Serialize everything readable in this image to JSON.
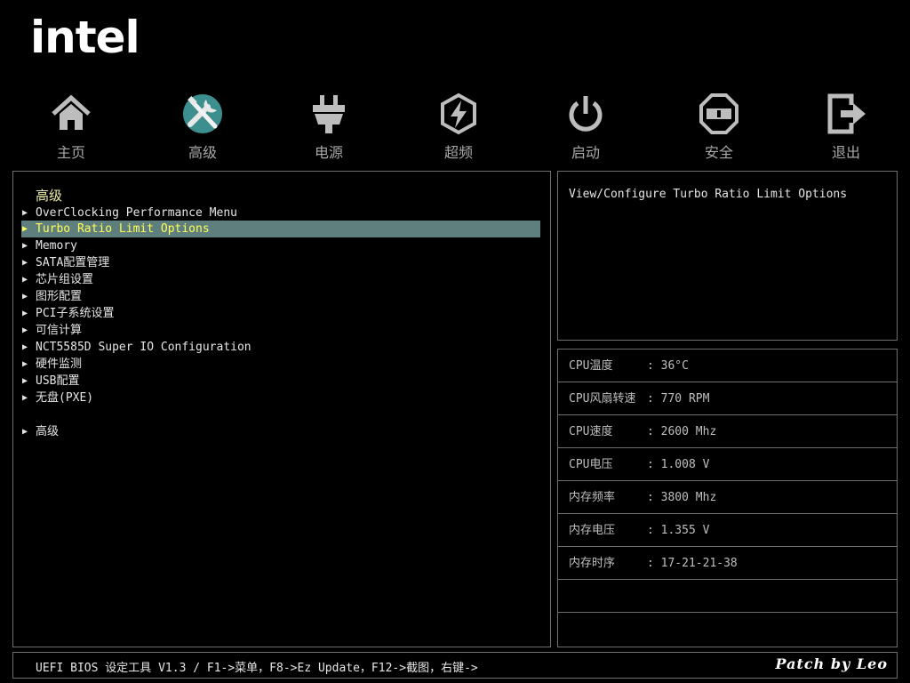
{
  "brand": {
    "logo_text": "intel"
  },
  "nav": {
    "items": [
      {
        "label": "主页",
        "icon": "home-icon"
      },
      {
        "label": "高级",
        "icon": "tools-icon",
        "active": true
      },
      {
        "label": "电源",
        "icon": "power-plug-icon"
      },
      {
        "label": "超频",
        "icon": "overclock-icon"
      },
      {
        "label": "启动",
        "icon": "power-button-icon"
      },
      {
        "label": "安全",
        "icon": "shield-icon"
      },
      {
        "label": "退出",
        "icon": "exit-icon"
      }
    ]
  },
  "menu": {
    "title": "高级",
    "items": [
      {
        "label": "OverClocking Performance Menu"
      },
      {
        "label": "Turbo Ratio Limit Options",
        "selected": true
      },
      {
        "label": "Memory"
      },
      {
        "label": "SATA配置管理"
      },
      {
        "label": "芯片组设置"
      },
      {
        "label": "图形配置"
      },
      {
        "label": "PCI子系统设置"
      },
      {
        "label": "可信计算"
      },
      {
        "label": "NCT5585D Super IO Configuration"
      },
      {
        "label": "硬件监测"
      },
      {
        "label": "USB配置"
      },
      {
        "label": "无盘(PXE)"
      },
      {
        "label": "高级"
      }
    ]
  },
  "help": {
    "text": "View/Configure Turbo Ratio Limit Options"
  },
  "status": {
    "rows": [
      {
        "label": "CPU温度",
        "value": ": 36°C"
      },
      {
        "label": "CPU风扇转速",
        "value": ": 770 RPM"
      },
      {
        "label": "CPU速度",
        "value": ": 2600 Mhz"
      },
      {
        "label": "CPU电压",
        "value": ": 1.008 V"
      },
      {
        "label": "内存频率",
        "value": ": 3800 Mhz"
      },
      {
        "label": "内存电压",
        "value": ": 1.355 V"
      },
      {
        "label": "内存时序",
        "value": ": 17-21-21-38"
      },
      {
        "label": "",
        "value": ""
      },
      {
        "label": "",
        "value": ""
      }
    ]
  },
  "footer": {
    "text": "UEFI BIOS 设定工具 V1.3 / F1->菜单，F8->Ez Update，F12->截图，右键->",
    "signature": "Patch by Leo"
  },
  "colors": {
    "selection_bg": "#5f7f7f",
    "selection_text": "#ffff55",
    "title_text": "#ededa6",
    "border": "#6e6e6e"
  }
}
